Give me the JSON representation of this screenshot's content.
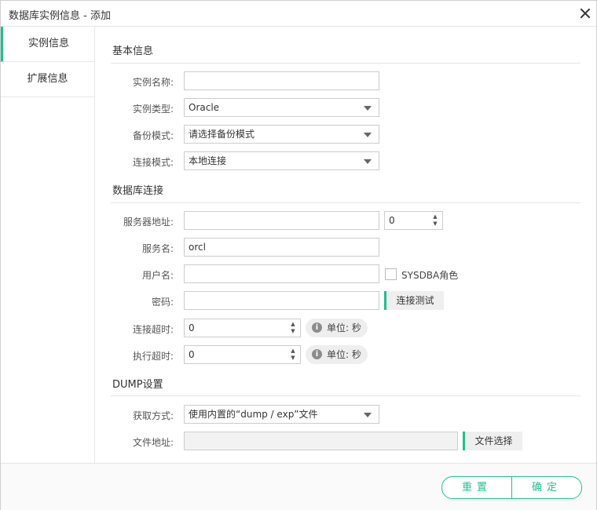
{
  "window": {
    "title": "数据库实例信息 - 添加"
  },
  "sidebar": {
    "tabs": [
      {
        "label": "实例信息"
      },
      {
        "label": "扩展信息"
      }
    ]
  },
  "basic": {
    "section_title": "基本信息",
    "instance_name": {
      "label": "实例名称:",
      "value": ""
    },
    "instance_type": {
      "label": "实例类型:",
      "value": "Oracle"
    },
    "backup_mode": {
      "label": "备份模式:",
      "value": "请选择备份模式"
    },
    "connect_mode": {
      "label": "连接模式:",
      "value": "本地连接"
    }
  },
  "db": {
    "section_title": "数据库连接",
    "server_address": {
      "label": "服务器地址:",
      "value": "",
      "port": "0"
    },
    "service_name": {
      "label": "服务名:",
      "value": "orcl"
    },
    "username": {
      "label": "用户名:",
      "value": "",
      "sysdba_label": "SYSDBA角色"
    },
    "password": {
      "label": "密码:",
      "value": "",
      "test_button": "连接测试"
    },
    "connect_timeout": {
      "label": "连接超时:",
      "value": "0",
      "unit": "单位: 秒"
    },
    "exec_timeout": {
      "label": "执行超时:",
      "value": "0",
      "unit": "单位: 秒"
    }
  },
  "dump": {
    "section_title": "DUMP设置",
    "method": {
      "label": "获取方式:",
      "value": "使用内置的“dump / exp”文件"
    },
    "file_address": {
      "label": "文件地址:",
      "value": "",
      "choose_button": "文件选择"
    }
  },
  "footer": {
    "reset": "重置",
    "confirm": "确定"
  },
  "colors": {
    "accent": "#1fc08e"
  }
}
